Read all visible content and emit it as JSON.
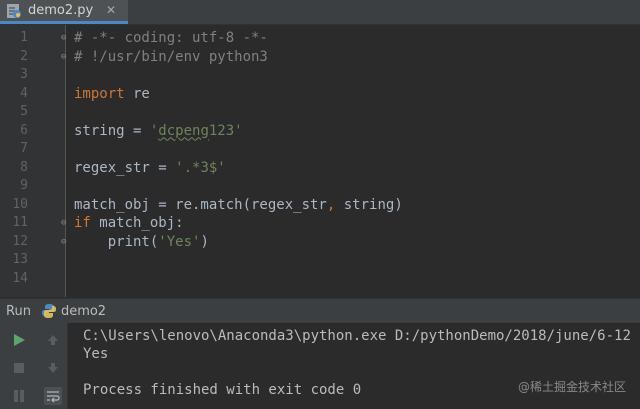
{
  "editor": {
    "tab_label": "demo2.py",
    "lines": [
      {
        "no": "1",
        "tokens": [
          {
            "t": "# -*- coding: utf-8 -*-",
            "c": "cm"
          }
        ]
      },
      {
        "no": "2",
        "tokens": [
          {
            "t": "# !/usr/bin/env python3",
            "c": "cm"
          }
        ]
      },
      {
        "no": "3",
        "tokens": []
      },
      {
        "no": "4",
        "tokens": [
          {
            "t": "import",
            "c": "kw"
          },
          {
            "t": " re",
            "c": ""
          }
        ]
      },
      {
        "no": "5",
        "tokens": []
      },
      {
        "no": "6",
        "tokens": [
          {
            "t": "string = ",
            "c": ""
          },
          {
            "t": "'",
            "c": "str"
          },
          {
            "t": "dcpeng",
            "c": "str squig"
          },
          {
            "t": "123'",
            "c": "str"
          }
        ]
      },
      {
        "no": "7",
        "tokens": []
      },
      {
        "no": "8",
        "tokens": [
          {
            "t": "regex_str = ",
            "c": ""
          },
          {
            "t": "'.*3$'",
            "c": "str"
          }
        ]
      },
      {
        "no": "9",
        "tokens": []
      },
      {
        "no": "10",
        "tokens": [
          {
            "t": "match_obj = re.match(regex_str",
            "c": ""
          },
          {
            "t": ",",
            "c": "kw"
          },
          {
            "t": " string)",
            "c": ""
          }
        ]
      },
      {
        "no": "11",
        "tokens": [
          {
            "t": "if",
            "c": "kw"
          },
          {
            "t": " match_obj:",
            "c": ""
          }
        ]
      },
      {
        "no": "12",
        "tokens": [
          {
            "t": "    print(",
            "c": ""
          },
          {
            "t": "'Yes'",
            "c": "str"
          },
          {
            "t": ")",
            "c": ""
          }
        ]
      },
      {
        "no": "13",
        "tokens": []
      },
      {
        "no": "14",
        "tokens": []
      }
    ]
  },
  "run_panel": {
    "title": "Run",
    "config_name": "demo2",
    "console_lines": [
      "C:\\Users\\lenovo\\Anaconda3\\python.exe D:/pythonDemo/2018/june/6-12",
      "Yes",
      "",
      "Process finished with exit code 0"
    ]
  },
  "watermark": "@稀土掘金技术社区",
  "icons": {
    "run": "play-icon",
    "stop": "stop-icon",
    "pause": "pause-icon",
    "up": "arrow-up-icon",
    "down": "arrow-down-icon",
    "wrap": "soft-wrap-icon",
    "file": "python-file-icon"
  },
  "colors": {
    "background": "#2b2b2b",
    "keyword": "#cc7832",
    "string": "#6a8759",
    "comment": "#808080",
    "run_green": "#59a869"
  }
}
